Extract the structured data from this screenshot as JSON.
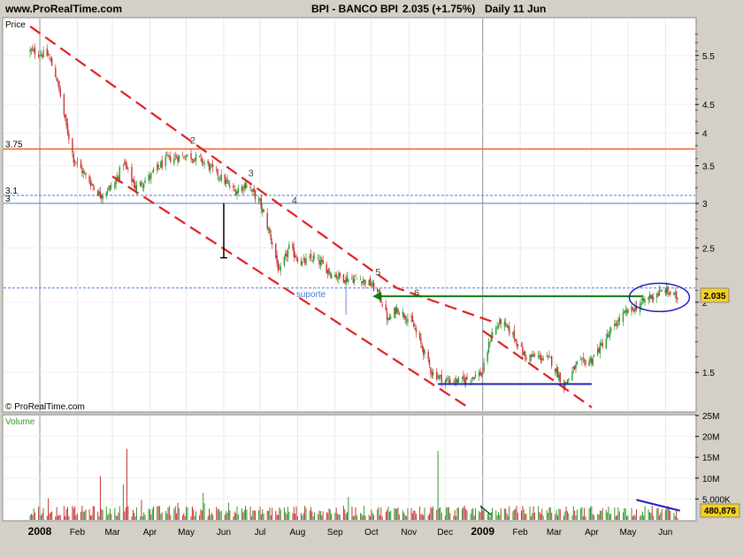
{
  "header": {
    "site": "www.ProRealTime.com",
    "instrument": "BPI - BANCO BPI",
    "quote": "2.035 (+1.75%)",
    "period": "Daily 11 Jun"
  },
  "price_panel": {
    "label": "Price",
    "watermark": "© ProRealTime.com",
    "current_price_tag": "2.035"
  },
  "volume_panel": {
    "label": "Volume",
    "current_volume_tag": "480,876"
  },
  "colors": {
    "background": "#ffffff",
    "chrome": "#d4d0c8",
    "up_candle": "#2e9a2e",
    "down_candle": "#c83232",
    "channel_lines": "#e02020",
    "resistance": "#e8602a",
    "support_dashed": "#4a7ad0",
    "arrow": "#0a7a0a",
    "base_line": "#2020c0",
    "price_tag": "#f5d020"
  },
  "chart_data": [
    {
      "type": "candlestick",
      "title": "BPI - BANCO BPI",
      "ylabel": "Price",
      "y_scale": "log",
      "ylim": [
        1.28,
        6.4
      ],
      "y_ticks": [
        "1.5",
        "2",
        "2.5",
        "3",
        "3.5",
        "4",
        "4.5",
        "5.5"
      ],
      "x_ticks": [
        "2008",
        "Feb",
        "Mar",
        "Apr",
        "May",
        "Jun",
        "Jul",
        "Aug",
        "Sep",
        "Oct",
        "Nov",
        "Dec",
        "2009",
        "Feb",
        "Mar",
        "Apr",
        "May",
        "Jun"
      ],
      "x_tick_dates": [
        "2008-01-01",
        "2008-02-01",
        "2008-03-01",
        "2008-04-01",
        "2008-05-01",
        "2008-06-01",
        "2008-07-01",
        "2008-08-01",
        "2008-09-01",
        "2008-10-01",
        "2008-11-01",
        "2008-12-01",
        "2009-01-01",
        "2009-02-01",
        "2009-03-01",
        "2009-04-01",
        "2009-05-01",
        "2009-06-01"
      ],
      "grid": true,
      "close_path": [
        [
          "2007-12-24",
          5.6
        ],
        [
          "2008-01-08",
          5.5
        ],
        [
          "2008-01-15",
          5.0
        ],
        [
          "2008-01-22",
          4.2
        ],
        [
          "2008-01-29",
          3.6
        ],
        [
          "2008-02-08",
          3.35
        ],
        [
          "2008-02-20",
          3.1
        ],
        [
          "2008-03-03",
          3.25
        ],
        [
          "2008-03-10",
          3.55
        ],
        [
          "2008-03-20",
          3.2
        ],
        [
          "2008-04-01",
          3.35
        ],
        [
          "2008-04-15",
          3.6
        ],
        [
          "2008-05-01",
          3.65
        ],
        [
          "2008-05-12",
          3.6
        ],
        [
          "2008-05-26",
          3.4
        ],
        [
          "2008-06-10",
          3.15
        ],
        [
          "2008-06-20",
          3.25
        ],
        [
          "2008-07-01",
          3.0
        ],
        [
          "2008-07-10",
          2.6
        ],
        [
          "2008-07-17",
          2.25
        ],
        [
          "2008-07-25",
          2.5
        ],
        [
          "2008-08-04",
          2.35
        ],
        [
          "2008-08-15",
          2.4
        ],
        [
          "2008-08-29",
          2.25
        ],
        [
          "2008-09-10",
          2.2
        ],
        [
          "2008-09-22",
          2.2
        ],
        [
          "2008-10-01",
          2.15
        ],
        [
          "2008-10-08",
          2.05
        ],
        [
          "2008-10-15",
          1.85
        ],
        [
          "2008-10-22",
          1.95
        ],
        [
          "2008-11-03",
          1.85
        ],
        [
          "2008-11-10",
          1.7
        ],
        [
          "2008-11-20",
          1.5
        ],
        [
          "2008-12-01",
          1.45
        ],
        [
          "2008-12-15",
          1.45
        ],
        [
          "2009-01-01",
          1.5
        ],
        [
          "2009-01-08",
          1.75
        ],
        [
          "2009-01-16",
          1.85
        ],
        [
          "2009-01-26",
          1.75
        ],
        [
          "2009-02-05",
          1.6
        ],
        [
          "2009-02-16",
          1.6
        ],
        [
          "2009-02-26",
          1.58
        ],
        [
          "2009-03-09",
          1.42
        ],
        [
          "2009-03-20",
          1.55
        ],
        [
          "2009-04-01",
          1.58
        ],
        [
          "2009-04-15",
          1.75
        ],
        [
          "2009-04-27",
          1.9
        ],
        [
          "2009-05-06",
          1.95
        ],
        [
          "2009-05-13",
          2.0
        ],
        [
          "2009-05-20",
          2.05
        ],
        [
          "2009-06-01",
          2.1
        ],
        [
          "2009-06-11",
          2.035
        ]
      ],
      "last_close": 2.035,
      "annotations": {
        "horizontal_lines": [
          {
            "label": "3.75",
            "value": 3.75,
            "style": "solid",
            "color": "orange"
          },
          {
            "label": "3.1",
            "value": 3.1,
            "style": "dashed",
            "color": "blue"
          },
          {
            "label": "3",
            "value": 3.0,
            "style": "solid",
            "color": "blue"
          },
          {
            "label": "",
            "value": 2.12,
            "style": "dashed",
            "color": "blue"
          }
        ],
        "channel_upper": [
          [
            "2007-12-24",
            6.2
          ],
          [
            "2008-10-22",
            2.12
          ],
          [
            "2009-01-08",
            1.85
          ]
        ],
        "channel_lower": [
          [
            "2008-03-01",
            3.35
          ],
          [
            "2008-12-20",
            1.3
          ]
        ],
        "trend_line_2009": [
          [
            "2009-01-01",
            1.78
          ],
          [
            "2009-04-01",
            1.3
          ]
        ],
        "points": [
          {
            "label": "2",
            "date": "2008-05-02",
            "price": 3.78
          },
          {
            "label": "3",
            "date": "2008-06-19",
            "price": 3.3
          },
          {
            "label": "4",
            "date": "2008-07-25",
            "price": 2.95
          },
          {
            "label": "5",
            "date": "2008-10-02",
            "price": 2.2
          },
          {
            "label": "6",
            "date": "2008-11-03",
            "price": 2.02
          }
        ],
        "suporte_label": "suporte",
        "arrow": {
          "from_date": "2009-05-13",
          "to_date": "2008-10-02",
          "price": 2.05
        },
        "base_line": {
          "from_date": "2008-11-25",
          "to_date": "2009-04-01",
          "price": 1.43
        },
        "ellipse": {
          "center_date": "2009-05-27",
          "price": 2.04
        }
      }
    },
    {
      "type": "bar",
      "title": "Volume",
      "ylabel": "Volume",
      "ylim": [
        0,
        25000000
      ],
      "y_ticks": [
        "5,000K",
        "10M",
        "15M",
        "20M",
        "25M"
      ],
      "last_value": 480876,
      "notable_spikes": [
        {
          "date": "2008-02-20",
          "value": 10500000
        },
        {
          "date": "2008-03-13",
          "value": 17000000
        },
        {
          "date": "2008-03-10",
          "value": 8500000
        },
        {
          "date": "2008-11-25",
          "value": 16500000
        }
      ]
    }
  ]
}
